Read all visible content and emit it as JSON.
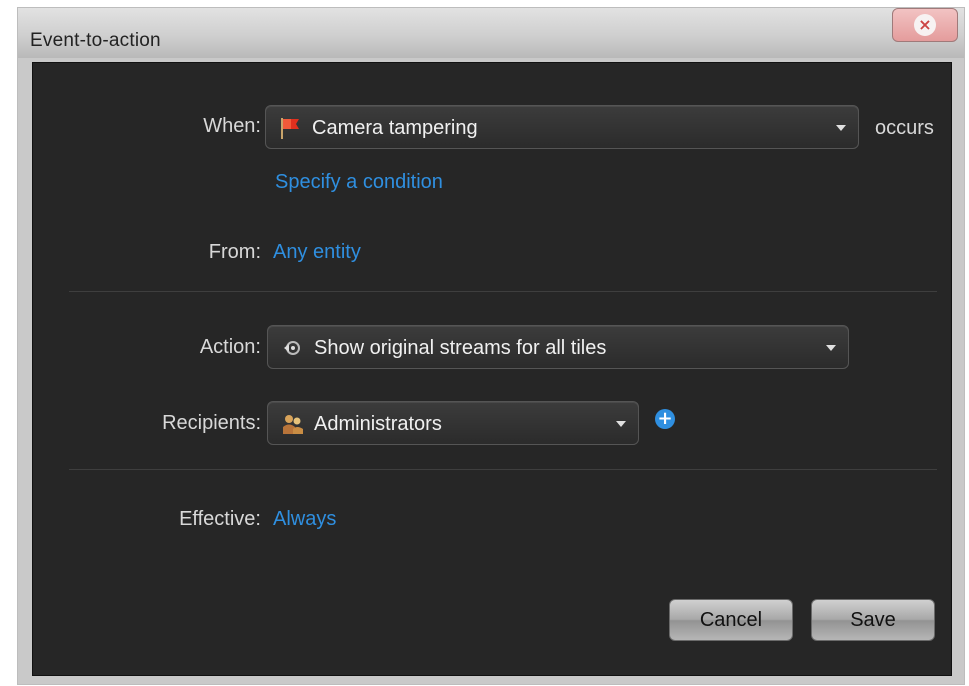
{
  "window": {
    "title": "Event-to-action",
    "close_icon": "close-icon"
  },
  "when": {
    "label": "When:",
    "value": "Camera tampering",
    "icon": "red-flag-icon",
    "suffix": "occurs",
    "condition_link": "Specify a condition"
  },
  "from": {
    "label": "From:",
    "value": "Any entity"
  },
  "action": {
    "label": "Action:",
    "value": "Show original streams for all tiles",
    "icon": "stream-icon"
  },
  "recipients": {
    "label": "Recipients:",
    "value": "Administrators",
    "icon": "user-group-icon",
    "add_icon": "add-icon"
  },
  "effective": {
    "label": "Effective:",
    "value": "Always"
  },
  "buttons": {
    "cancel": "Cancel",
    "save": "Save"
  },
  "colors": {
    "panel": "#262626",
    "link": "#2f8fe0",
    "flag": "#e0301e"
  }
}
